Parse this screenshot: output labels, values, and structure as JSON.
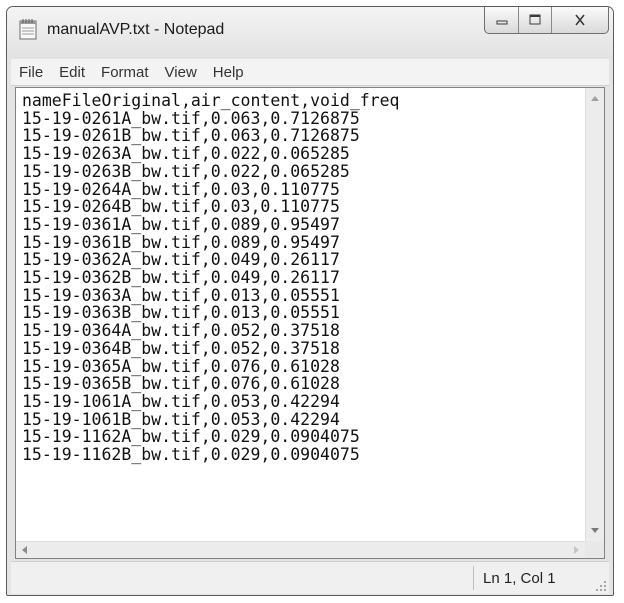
{
  "window": {
    "title": "manualAVP.txt - Notepad",
    "icon": "notepad-icon",
    "controls": [
      "minimize-icon",
      "maximize-icon",
      "close-icon"
    ]
  },
  "menu": {
    "items": [
      "File",
      "Edit",
      "Format",
      "View",
      "Help"
    ]
  },
  "editor": {
    "lines": [
      "nameFileOriginal,air_content,void_freq",
      "15-19-0261A_bw.tif,0.063,0.7126875",
      "15-19-0261B_bw.tif,0.063,0.7126875",
      "15-19-0263A_bw.tif,0.022,0.065285",
      "15-19-0263B_bw.tif,0.022,0.065285",
      "15-19-0264A_bw.tif,0.03,0.110775",
      "15-19-0264B_bw.tif,0.03,0.110775",
      "15-19-0361A_bw.tif,0.089,0.95497",
      "15-19-0361B_bw.tif,0.089,0.95497",
      "15-19-0362A_bw.tif,0.049,0.26117",
      "15-19-0362B_bw.tif,0.049,0.26117",
      "15-19-0363A_bw.tif,0.013,0.05551",
      "15-19-0363B_bw.tif,0.013,0.05551",
      "15-19-0364A_bw.tif,0.052,0.37518",
      "15-19-0364B_bw.tif,0.052,0.37518",
      "15-19-0365A_bw.tif,0.076,0.61028",
      "15-19-0365B_bw.tif,0.076,0.61028",
      "15-19-1061A_bw.tif,0.053,0.42294",
      "15-19-1061B_bw.tif,0.053,0.42294",
      "15-19-1162A_bw.tif,0.029,0.0904075",
      "15-19-1162B_bw.tif,0.029,0.0904075"
    ]
  },
  "status": {
    "position": "Ln 1, Col 1"
  }
}
